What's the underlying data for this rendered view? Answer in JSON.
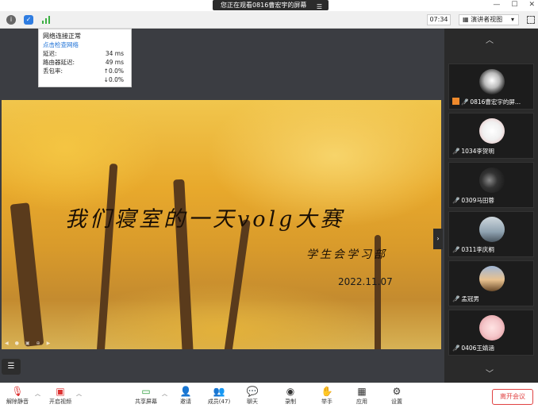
{
  "titlebar": {
    "share_text": "您正在观看0816曹宏宇的屏幕",
    "share_menu_icon": "menu-lines-icon",
    "window_controls": [
      "—",
      "☐",
      "✕"
    ]
  },
  "toolbar": {
    "info_icon": "info-icon",
    "shield_icon": "shield-icon",
    "signal_icon": "signal-icon",
    "timer": "07:34",
    "view_label": "演讲者视图",
    "view_caret": "▾",
    "fullscreen_icon": "fullscreen-icon"
  },
  "network_popup": {
    "status": "网络连接正常",
    "check_link": "点击检查网络",
    "latency_label": "延迟:",
    "latency_value": "34 ms",
    "router_label": "路由器延迟:",
    "router_value": "49 ms",
    "loss_label": "丢包率:",
    "loss_up": "↑0.0%",
    "loss_down": "↓0.0%"
  },
  "slide": {
    "title": "我们寝室的一天volg大赛",
    "department": "学生会学习部",
    "date": "2022.11.07"
  },
  "sidebar": {
    "participants": [
      {
        "name": "0816曹宏宇的屏...",
        "sharing": true,
        "avatar_color": "#d9d9d9"
      },
      {
        "name": "1034李贺明",
        "sharing": false,
        "avatar_color": "#f2f2f2"
      },
      {
        "name": "0309马田蓉",
        "sharing": false,
        "avatar_color": "#2a2a2a"
      },
      {
        "name": "0311李庆桐",
        "sharing": false,
        "avatar_color": "#8fa2b0"
      },
      {
        "name": "孟冠男",
        "sharing": false,
        "avatar_color": "#d8a86d"
      },
      {
        "name": "0406王婧涵",
        "sharing": false,
        "avatar_color": "#f4c6c9"
      }
    ]
  },
  "bottombar": {
    "unmute": "解除静音",
    "video": "开启视频",
    "share": "共享屏幕",
    "invite": "邀请",
    "members": "成员(47)",
    "chat": "聊天",
    "record": "录制",
    "raise_hand": "举手",
    "apps": "应用",
    "settings": "设置",
    "leave": "离开会议"
  },
  "colors": {
    "stage_bg": "#3b3d42",
    "sidebar_bg": "#2a2a2a",
    "leave_red": "#e04343",
    "link_blue": "#1a6fd6"
  }
}
